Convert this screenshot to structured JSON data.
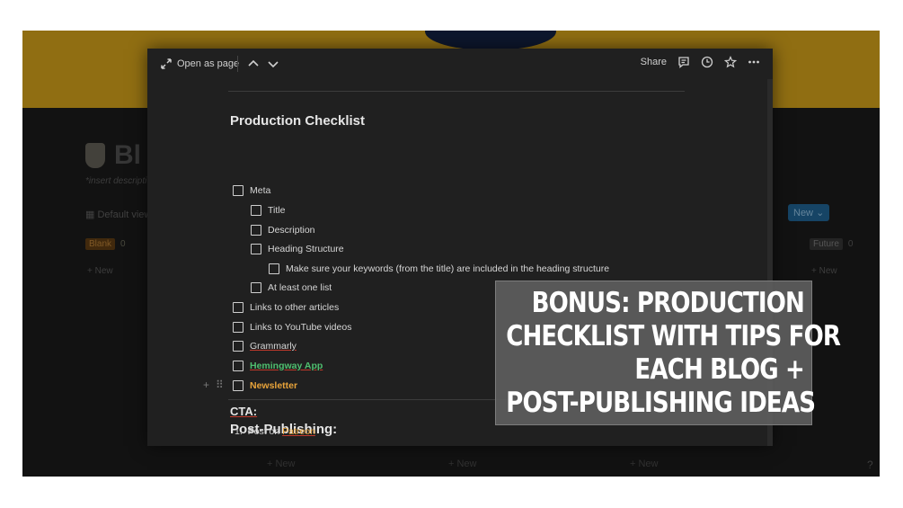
{
  "background": {
    "page_title": "Bl",
    "description": "*insert descripti",
    "view_label": "Default view",
    "blank_group": {
      "label": "Blank",
      "count": "0"
    },
    "future_group": {
      "label": "Future",
      "count": "0"
    },
    "new_label": "+ New",
    "new_button": "New",
    "help": "?"
  },
  "modal": {
    "topbar": {
      "open_as_page": "Open as page",
      "share": "Share"
    },
    "production_heading": "Production Checklist",
    "checklist": [
      {
        "label": "Meta",
        "indent": 0
      },
      {
        "label": "Title",
        "indent": 1
      },
      {
        "label": "Description",
        "indent": 1
      },
      {
        "label": "Heading Structure",
        "indent": 1
      },
      {
        "label": "Make sure your keywords (from the title) are included in the heading structure",
        "indent": 2
      },
      {
        "label": "At least one list",
        "indent": 1
      },
      {
        "label": "Links to other articles",
        "indent": 0
      },
      {
        "label": "Links to YouTube videos",
        "indent": 0
      },
      {
        "label": "Grammarly",
        "indent": 0
      },
      {
        "label": "Hemingway App",
        "indent": 0
      },
      {
        "label": "Newsletter",
        "indent": 0
      }
    ],
    "post_publishing_heading": "Post-Publishing:",
    "cta_heading": "CTA:",
    "cta_items": [
      {
        "number": "1.",
        "prefix": "Post on ",
        "link": "Patreon"
      }
    ]
  },
  "overlay": {
    "lines": [
      "BONUS: PRODUCTION",
      "CHECKLIST WITH TIPS FOR",
      "EACH BLOG +",
      "POST-PUBLISHING IDEAS"
    ]
  },
  "colors": {
    "banner": "#c8991a",
    "modal_bg": "#202020",
    "link_green": "#4fbf6f",
    "accent_orange": "#e8a33a"
  }
}
